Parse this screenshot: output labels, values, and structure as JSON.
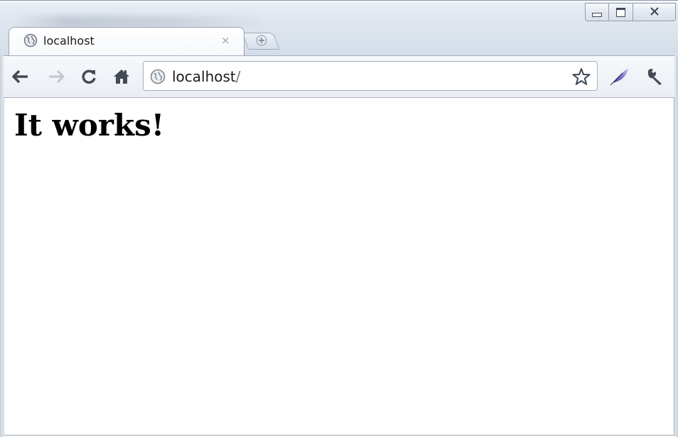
{
  "tab": {
    "title": "localhost",
    "close_glyph": "×",
    "favicon": "globe-icon"
  },
  "window_controls": {
    "minimize": "minimize-icon",
    "maximize": "restore-icon",
    "close_glyph": "X"
  },
  "toolbar": {
    "back": "back-arrow-icon",
    "forward": "forward-arrow-icon",
    "reload": "reload-icon",
    "home": "home-icon",
    "extension": "feather-icon",
    "settings": "wrench-icon"
  },
  "omnibox": {
    "host": "localhost",
    "path": "/",
    "bookmark": "star-icon"
  },
  "page": {
    "heading": "It works!"
  },
  "colors": {
    "frame": "#dfe6ef",
    "toolbar": "#eef2f6",
    "text": "#000000"
  }
}
